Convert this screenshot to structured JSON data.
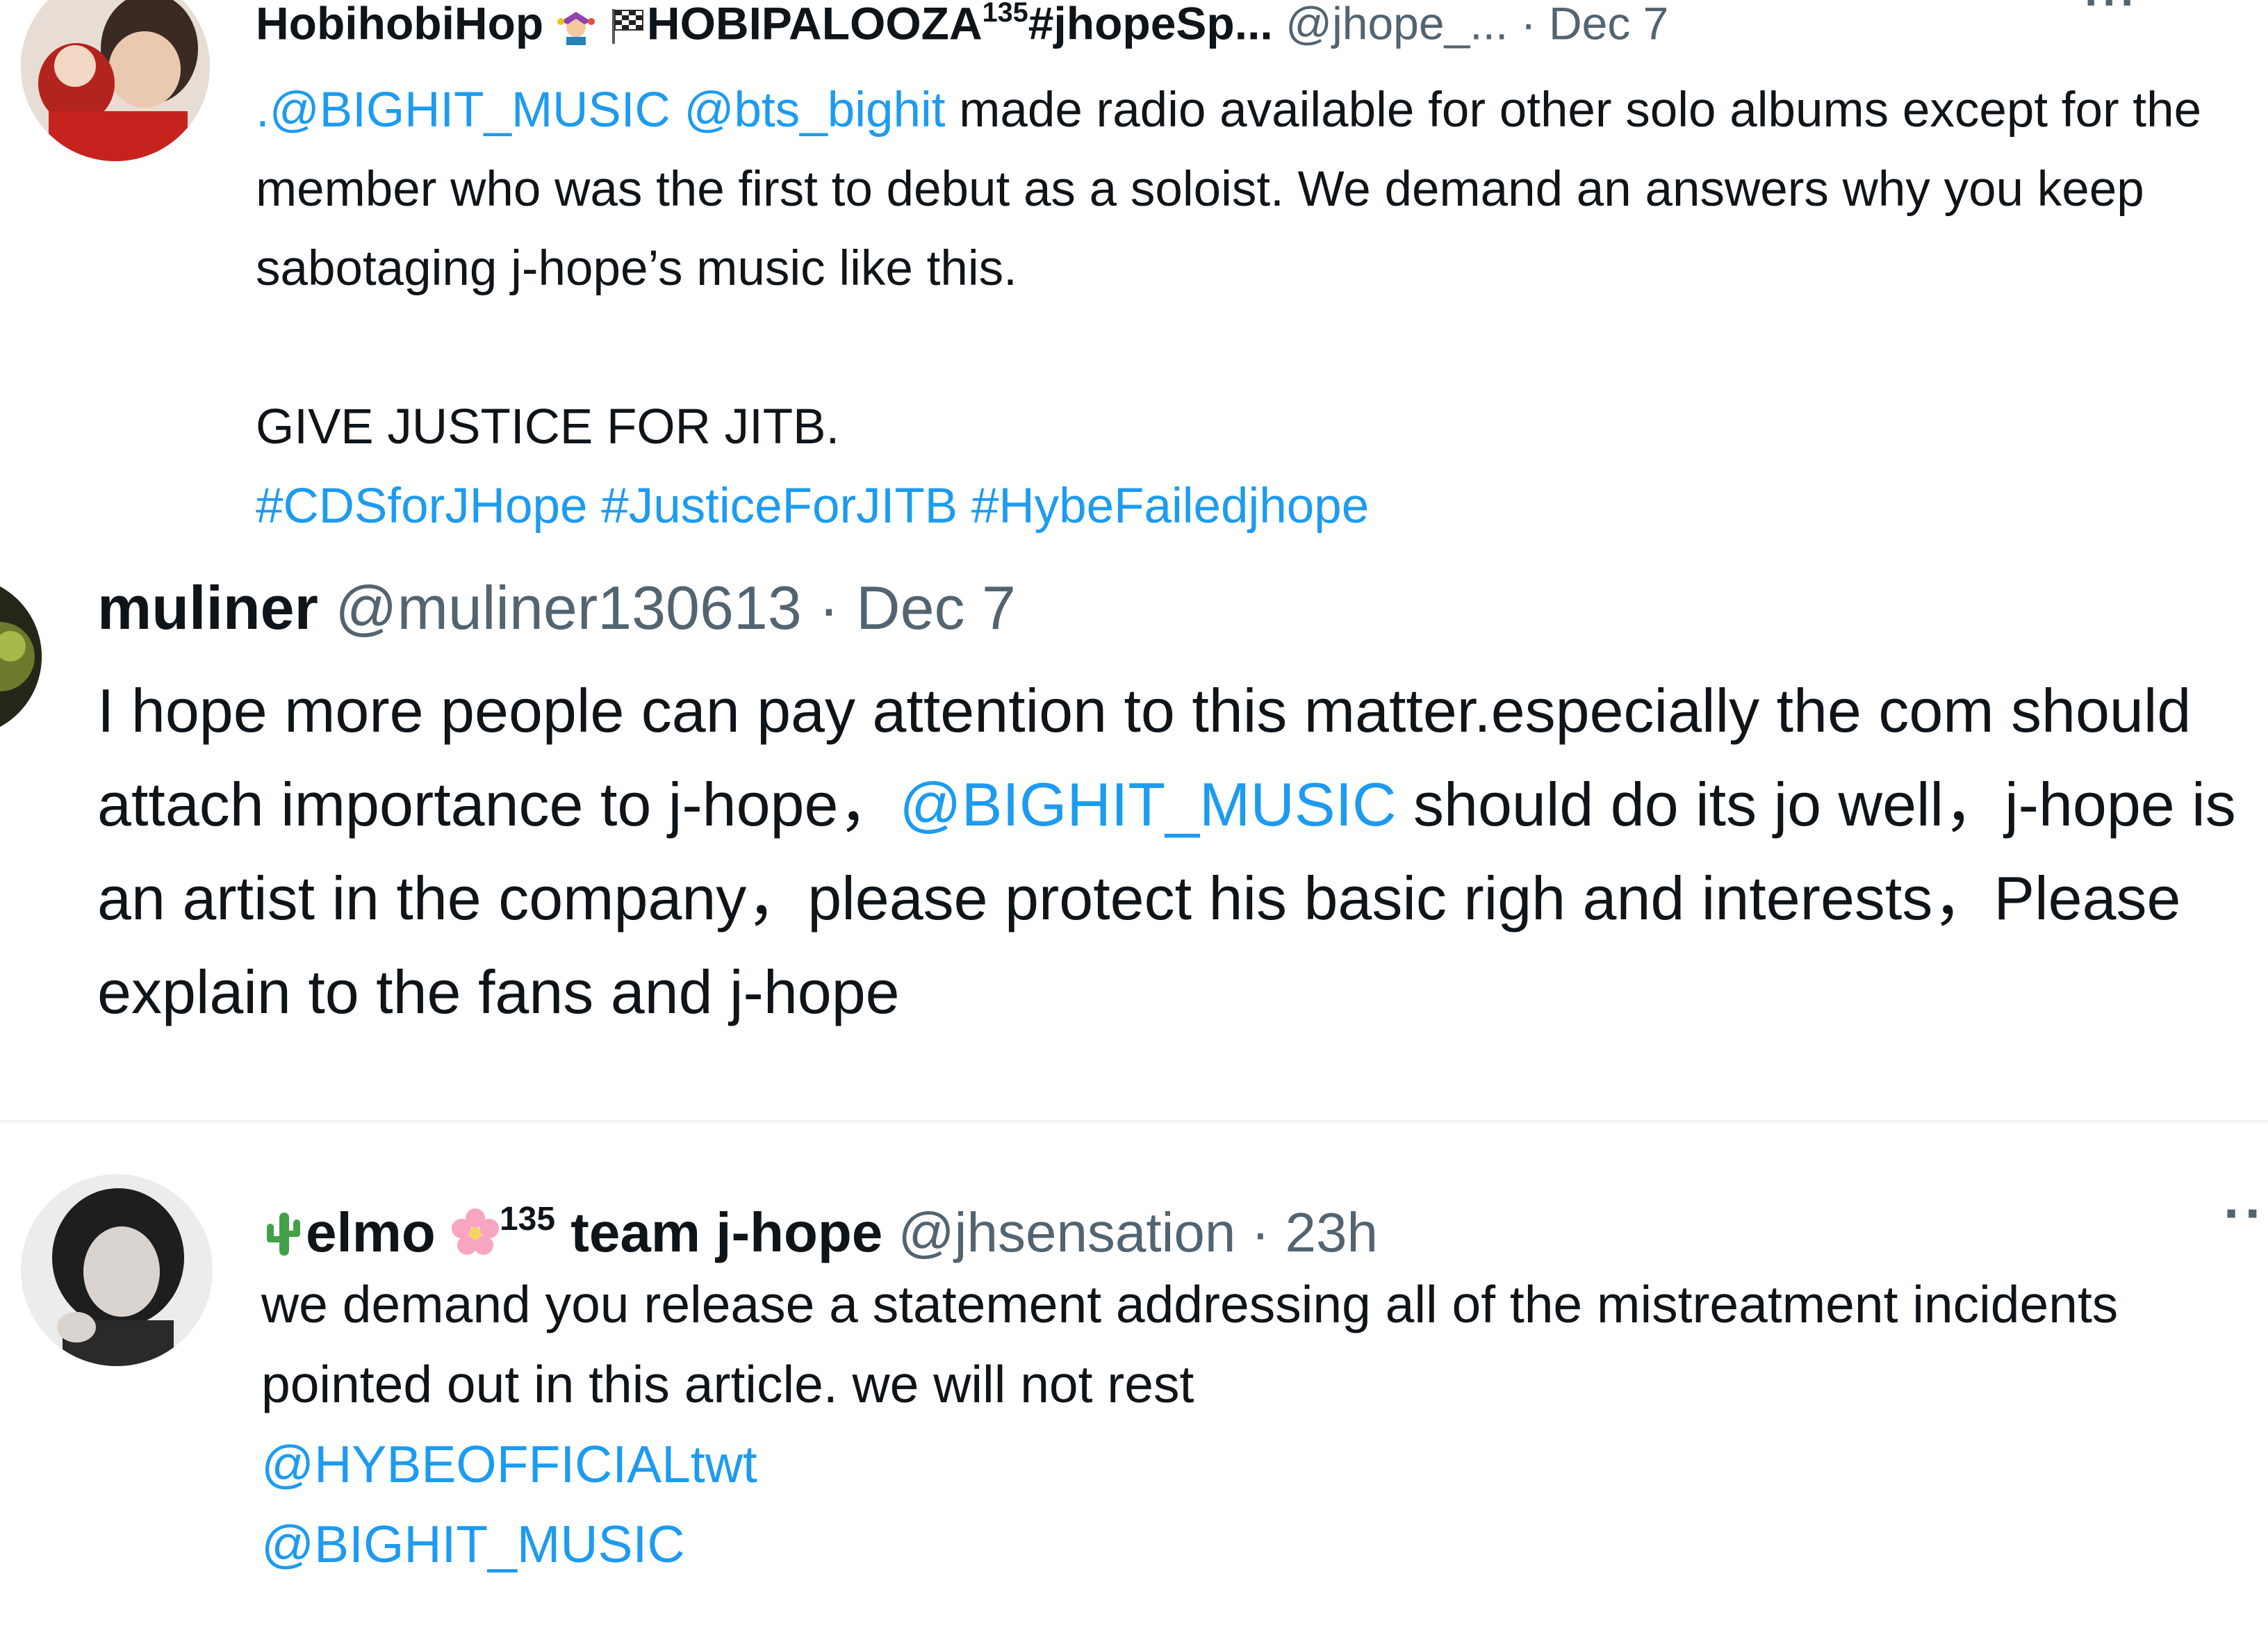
{
  "colors": {
    "link": "#1d9bf0",
    "text": "#0f1419",
    "secondary": "#536471",
    "divider": "#eff3f4"
  },
  "tweets": [
    {
      "name": "HobihobiHop",
      "name_emoji_icon": "jester-emoji-icon",
      "flag_icon": "checkered-flag-icon",
      "name_suffix": "HOBIPALOOZA",
      "name_superscript": "135",
      "name_tag": "#jhopeSp...",
      "handle": "@jhope_...",
      "time": "· Dec 7",
      "more": "···",
      "mention_1": ".@BIGHIT_MUSIC",
      "mention_2": "@bts_bighit",
      "text_1": " made radio available for other solo albums except for the member who was the first to debut as a soloist. We demand an answers why you keep sabotaging j-hope’s music like this.",
      "text_2": "GIVE JUSTICE FOR JITB.",
      "hashtags": "#CDSforJHope #JusticeForJITB #HybeFailedjhope"
    },
    {
      "name": "muliner",
      "handle": "@muliner130613",
      "time": "· Dec 7",
      "text_1": "I hope more people can pay attention to this matter.especially the com should attach importance to j-hope，",
      "mention": "@BIGHIT_MUSIC",
      "text_2": " should do its jo well，j-hope is an artist in the company，please protect his basic righ and interests，Please explain to the fans and j-hope"
    },
    {
      "name_emoji_icon": "cactus-emoji-icon",
      "name": "elmo",
      "name_emoji_2_icon": "cherry-blossom-emoji-icon",
      "name_superscript": "135",
      "name_suffix": "team j-hope",
      "handle": "@jhsensation",
      "time": "· 23h",
      "more": "··",
      "text_1": "we demand you release a statement addressing all of the mistreatment incidents pointed out in this article. we will not rest",
      "mention_1": "@HYBEOFFICIALtwt",
      "mention_2": "@BIGHIT_MUSIC"
    }
  ]
}
